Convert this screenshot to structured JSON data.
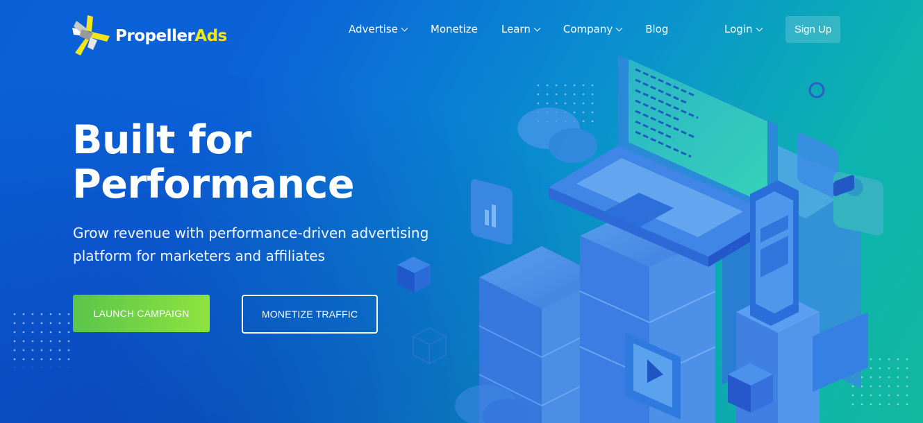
{
  "brand": {
    "name_part1": "Propeller",
    "name_part2": "Ads"
  },
  "nav": {
    "items": [
      {
        "label": "Advertise",
        "has_dropdown": true
      },
      {
        "label": "Monetize",
        "has_dropdown": false
      },
      {
        "label": "Learn",
        "has_dropdown": true
      },
      {
        "label": "Company",
        "has_dropdown": true
      },
      {
        "label": "Blog",
        "has_dropdown": false
      }
    ],
    "login_label": "Login",
    "signup_label": "Sign Up"
  },
  "hero": {
    "title_line1": "Built for",
    "title_line2": "Performance",
    "subtitle_line1": "Grow revenue with performance-driven advertising",
    "subtitle_line2": "platform for marketers and affiliates",
    "primary_cta": "LAUNCH CAMPAIGN",
    "secondary_cta": "MONETIZE TRAFFIC"
  },
  "colors": {
    "accent_green": "#7dd843",
    "brand_yellow": "#f2e51c",
    "bg_blue": "#0b63d8",
    "bg_teal": "#12b89d"
  },
  "icons": [
    "propellerads-logo-icon",
    "chevron-down-icon",
    "trophy-icon",
    "bar-chart-icon",
    "heart-chat-icon",
    "video-icon",
    "chat-icon",
    "cloud-icon",
    "laptop-icon",
    "phone-icon",
    "server-icon"
  ]
}
